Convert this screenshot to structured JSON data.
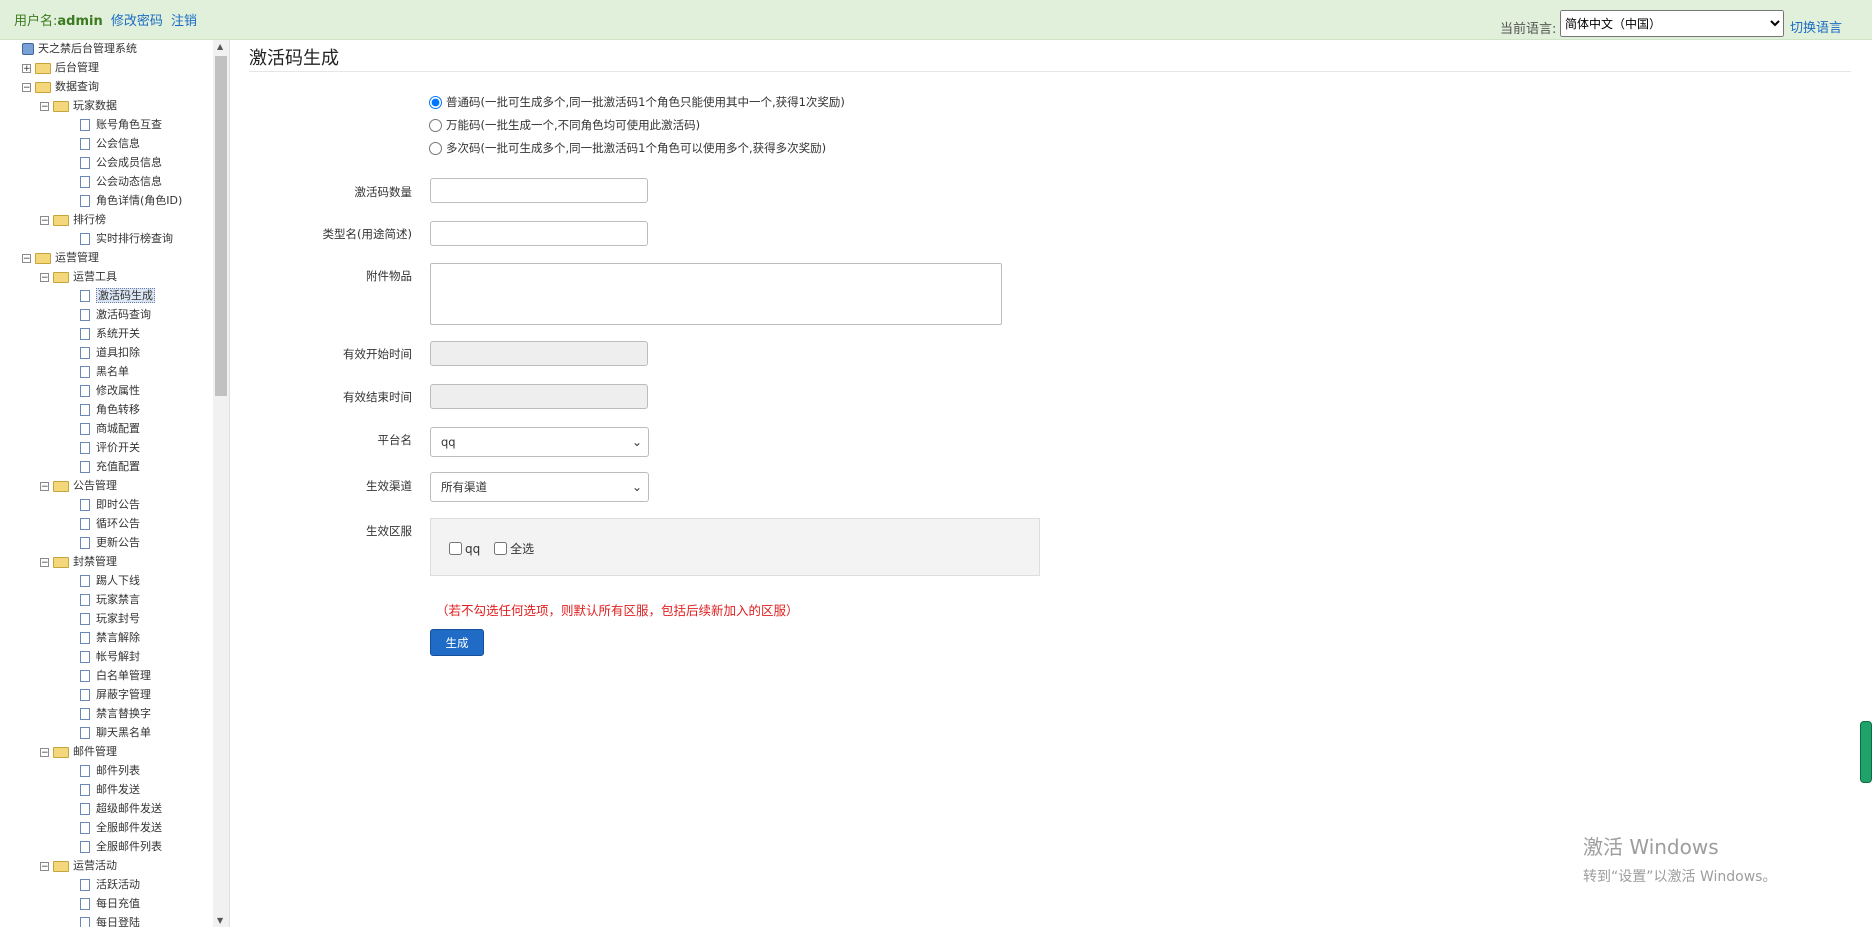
{
  "header": {
    "user_label": "用户名:",
    "username": "admin",
    "change_password": "修改密码",
    "logout": "注销",
    "language_label": "当前语言:",
    "language_selected": "简体中文（中国）",
    "switch_language": "切换语言"
  },
  "tree": {
    "root": "天之禁后台管理系统",
    "items": [
      {
        "label": "后台管理",
        "type": "folder",
        "expanded": false
      },
      {
        "label": "数据查询",
        "type": "folder",
        "expanded": true
      },
      {
        "label": "玩家数据",
        "type": "folder",
        "expanded": true
      },
      {
        "label": "账号角色互查",
        "type": "doc"
      },
      {
        "label": "公会信息",
        "type": "doc"
      },
      {
        "label": "公会成员信息",
        "type": "doc"
      },
      {
        "label": "公会动态信息",
        "type": "doc"
      },
      {
        "label": "角色详情(角色ID)",
        "type": "doc"
      },
      {
        "label": "排行榜",
        "type": "folder",
        "expanded": true
      },
      {
        "label": "实时排行榜查询",
        "type": "doc"
      },
      {
        "label": "运营管理",
        "type": "folder",
        "expanded": true
      },
      {
        "label": "运营工具",
        "type": "folder",
        "expanded": true
      },
      {
        "label": "激活码生成",
        "type": "doc",
        "selected": true
      },
      {
        "label": "激活码查询",
        "type": "doc"
      },
      {
        "label": "系统开关",
        "type": "doc"
      },
      {
        "label": "道具扣除",
        "type": "doc"
      },
      {
        "label": "黑名单",
        "type": "doc"
      },
      {
        "label": "修改属性",
        "type": "doc"
      },
      {
        "label": "角色转移",
        "type": "doc"
      },
      {
        "label": "商城配置",
        "type": "doc"
      },
      {
        "label": "评价开关",
        "type": "doc"
      },
      {
        "label": "充值配置",
        "type": "doc"
      },
      {
        "label": "公告管理",
        "type": "folder",
        "expanded": true
      },
      {
        "label": "即时公告",
        "type": "doc"
      },
      {
        "label": "循环公告",
        "type": "doc"
      },
      {
        "label": "更新公告",
        "type": "doc"
      },
      {
        "label": "封禁管理",
        "type": "folder",
        "expanded": true
      },
      {
        "label": "踢人下线",
        "type": "doc"
      },
      {
        "label": "玩家禁言",
        "type": "doc"
      },
      {
        "label": "玩家封号",
        "type": "doc"
      },
      {
        "label": "禁言解除",
        "type": "doc"
      },
      {
        "label": "帐号解封",
        "type": "doc"
      },
      {
        "label": "白名单管理",
        "type": "doc"
      },
      {
        "label": "屏蔽字管理",
        "type": "doc"
      },
      {
        "label": "禁言替换字",
        "type": "doc"
      },
      {
        "label": "聊天黑名单",
        "type": "doc"
      },
      {
        "label": "邮件管理",
        "type": "folder",
        "expanded": true
      },
      {
        "label": "邮件列表",
        "type": "doc"
      },
      {
        "label": "邮件发送",
        "type": "doc"
      },
      {
        "label": "超级邮件发送",
        "type": "doc"
      },
      {
        "label": "全服邮件发送",
        "type": "doc"
      },
      {
        "label": "全服邮件列表",
        "type": "doc"
      },
      {
        "label": "运营活动",
        "type": "folder",
        "expanded": true
      },
      {
        "label": "活跃活动",
        "type": "doc"
      },
      {
        "label": "每日充值",
        "type": "doc"
      },
      {
        "label": "每日登陆",
        "type": "doc"
      }
    ]
  },
  "main": {
    "title": "激活码生成",
    "code_types": [
      {
        "label": "普通码(一批可生成多个,同一批激活码1个角色只能使用其中一个,获得1次奖励)",
        "checked": true
      },
      {
        "label": "万能码(一批生成一个,不同角色均可使用此激活码)",
        "checked": false
      },
      {
        "label": "多次码(一批可生成多个,同一批激活码1个角色可以使用多个,获得多次奖励)",
        "checked": false
      }
    ],
    "fields": {
      "count_label": "激活码数量",
      "type_name_label": "类型名(用途简述)",
      "attachment_label": "附件物品",
      "start_time_label": "有效开始时间",
      "end_time_label": "有效结束时间",
      "platform_label": "平台名",
      "platform_value": "qq",
      "channel_label": "生效渠道",
      "channel_value": "所有渠道",
      "server_label": "生效区服"
    },
    "servers": [
      {
        "label": "qq",
        "checked": false
      },
      {
        "label": "全选",
        "checked": false
      }
    ],
    "note": "（若不勾选任何选项，则默认所有区服，包括后续新加入的区服）",
    "generate_button": "生成"
  },
  "watermark": {
    "line1": "激活 Windows",
    "line2": "转到“设置”以激活 Windows。"
  }
}
